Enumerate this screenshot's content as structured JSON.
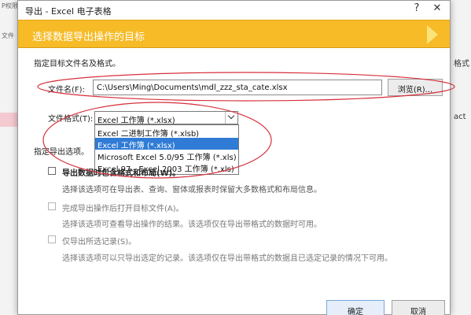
{
  "background": {
    "left_fragments": [
      "P权限",
      "文件"
    ],
    "right_fragments": [
      "格式",
      "act"
    ]
  },
  "dialog": {
    "title": "导出 - Excel 电子表格",
    "help_label": "?",
    "close_label": "✕",
    "banner_title": "选择数据导出操作的目标",
    "section_file_label": "指定目标文件名及格式。",
    "file_name_label": "文件名(F):",
    "file_name_value": "C:\\Users\\Ming\\Documents\\mdl_zzz_sta_cate.xlsx",
    "browse_label": "浏览(R)...",
    "file_format_label": "文件格式(T):",
    "file_format_value": "Excel 工作簿 (*.xlsx)",
    "format_options": [
      "Excel 二进制工作簿 (*.xlsb)",
      "Excel 工作簿 (*.xlsx)",
      "Microsoft Excel 5.0/95 工作簿 (*.xls)",
      "Excel 97 - Excel 2003 工作簿 (*.xls)"
    ],
    "selected_option_index": 1,
    "section_options_label": "指定导出选项。",
    "option1_label": "导出数据时包含格式和布局(W)。",
    "option1_desc": "选择该选项可在导出表、查询、窗体或报表时保留大多数格式和布局信息。",
    "option2_label": "完成导出操作后打开目标文件(A)。",
    "option2_desc": "选择该选项可查看导出操作的结果。该选项仅在导出带格式的数据时可用。",
    "option3_label": "仅导出所选记录(S)。",
    "option3_desc": "选择该选项可以只导出选定的记录。该选项仅在导出带格式的数据且已选定记录的情况下可用。",
    "ok_label": "确定",
    "cancel_label": "取消"
  },
  "colors": {
    "banner": "#f6bb27",
    "selection": "#2f7bd6",
    "annotation": "#d6303b"
  }
}
